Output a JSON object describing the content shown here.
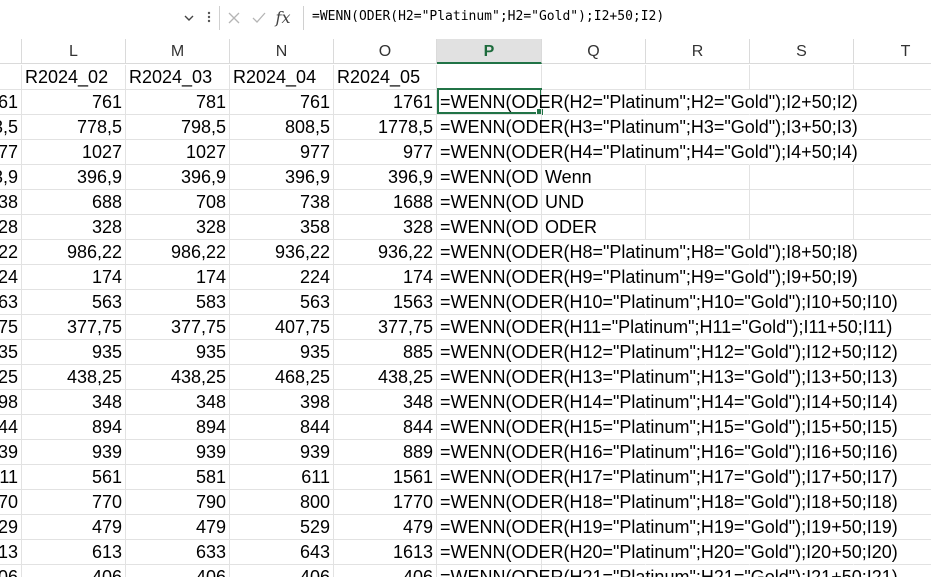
{
  "formula_bar": {
    "name_box": "",
    "formula": "=WENN(ODER(H2=\"Platinum\";H2=\"Gold\");I2+50;I2)",
    "fx_label": "fx"
  },
  "columns": [
    "L",
    "M",
    "N",
    "O",
    "P",
    "Q",
    "R",
    "S",
    "T"
  ],
  "selected_column": "P",
  "header_row": [
    "R2024_02",
    "R2024_03",
    "R2024_04",
    "R2024_05",
    ""
  ],
  "rows": [
    {
      "k": "61",
      "l": "761",
      "m": "781",
      "n": "761",
      "o": "1761",
      "p": "=WENN(ODER(H2=\"Platinum\";H2=\"Gold\");I2+50;I2)"
    },
    {
      "k": "3,5",
      "l": "778,5",
      "m": "798,5",
      "n": "808,5",
      "o": "1778,5",
      "p": "=WENN(ODER(H3=\"Platinum\";H3=\"Gold\");I3+50;I3)"
    },
    {
      "k": "77",
      "l": "1027",
      "m": "1027",
      "n": "977",
      "o": "977",
      "p": "=WENN(ODER(H4=\"Platinum\";H4=\"Gold\");I4+50;I4)"
    },
    {
      "k": "3,9",
      "l": "396,9",
      "m": "396,9",
      "n": "396,9",
      "o": "396,9",
      "p": "=WENN(OD",
      "q": "Wenn"
    },
    {
      "k": "38",
      "l": "688",
      "m": "708",
      "n": "738",
      "o": "1688",
      "p": "=WENN(OD",
      "q": "UND"
    },
    {
      "k": "28",
      "l": "328",
      "m": "328",
      "n": "358",
      "o": "328",
      "p": "=WENN(OD",
      "q": "ODER"
    },
    {
      "k": "22",
      "l": "986,22",
      "m": "986,22",
      "n": "936,22",
      "o": "936,22",
      "p": "=WENN(ODER(H8=\"Platinum\";H8=\"Gold\");I8+50;I8)"
    },
    {
      "k": "24",
      "l": "174",
      "m": "174",
      "n": "224",
      "o": "174",
      "p": "=WENN(ODER(H9=\"Platinum\";H9=\"Gold\");I9+50;I9)"
    },
    {
      "k": "63",
      "l": "563",
      "m": "583",
      "n": "563",
      "o": "1563",
      "p": "=WENN(ODER(H10=\"Platinum\";H10=\"Gold\");I10+50;I10)"
    },
    {
      "k": "75",
      "l": "377,75",
      "m": "377,75",
      "n": "407,75",
      "o": "377,75",
      "p": "=WENN(ODER(H11=\"Platinum\";H11=\"Gold\");I11+50;I11)"
    },
    {
      "k": "35",
      "l": "935",
      "m": "935",
      "n": "935",
      "o": "885",
      "p": "=WENN(ODER(H12=\"Platinum\";H12=\"Gold\");I12+50;I12)"
    },
    {
      "k": "25",
      "l": "438,25",
      "m": "438,25",
      "n": "468,25",
      "o": "438,25",
      "p": "=WENN(ODER(H13=\"Platinum\";H13=\"Gold\");I13+50;I13)"
    },
    {
      "k": "98",
      "l": "348",
      "m": "348",
      "n": "398",
      "o": "348",
      "p": "=WENN(ODER(H14=\"Platinum\";H14=\"Gold\");I14+50;I14)"
    },
    {
      "k": "44",
      "l": "894",
      "m": "894",
      "n": "844",
      "o": "844",
      "p": "=WENN(ODER(H15=\"Platinum\";H15=\"Gold\");I15+50;I15)"
    },
    {
      "k": "39",
      "l": "939",
      "m": "939",
      "n": "939",
      "o": "889",
      "p": "=WENN(ODER(H16=\"Platinum\";H16=\"Gold\");I16+50;I16)"
    },
    {
      "k": "11",
      "l": "561",
      "m": "581",
      "n": "611",
      "o": "1561",
      "p": "=WENN(ODER(H17=\"Platinum\";H17=\"Gold\");I17+50;I17)"
    },
    {
      "k": "70",
      "l": "770",
      "m": "790",
      "n": "800",
      "o": "1770",
      "p": "=WENN(ODER(H18=\"Platinum\";H18=\"Gold\");I18+50;I18)"
    },
    {
      "k": "29",
      "l": "479",
      "m": "479",
      "n": "529",
      "o": "479",
      "p": "=WENN(ODER(H19=\"Platinum\";H19=\"Gold\");I19+50;I19)"
    },
    {
      "k": "13",
      "l": "613",
      "m": "633",
      "n": "643",
      "o": "1613",
      "p": "=WENN(ODER(H20=\"Platinum\";H20=\"Gold\");I20+50;I20)"
    },
    {
      "k": "06",
      "l": "406",
      "m": "406",
      "n": "406",
      "o": "406",
      "p": "=WENN(ODER(H21=\"Platinum\";H21=\"Gold\");I21+50;I21)"
    }
  ],
  "colors": {
    "selection": "#217346",
    "gridline": "#e2e2e2",
    "header_selected_bg": "#e1e1e1"
  },
  "icons": [
    "chevron-down-icon",
    "more-options-icon",
    "cancel-icon",
    "enter-icon",
    "insert-function-icon"
  ]
}
